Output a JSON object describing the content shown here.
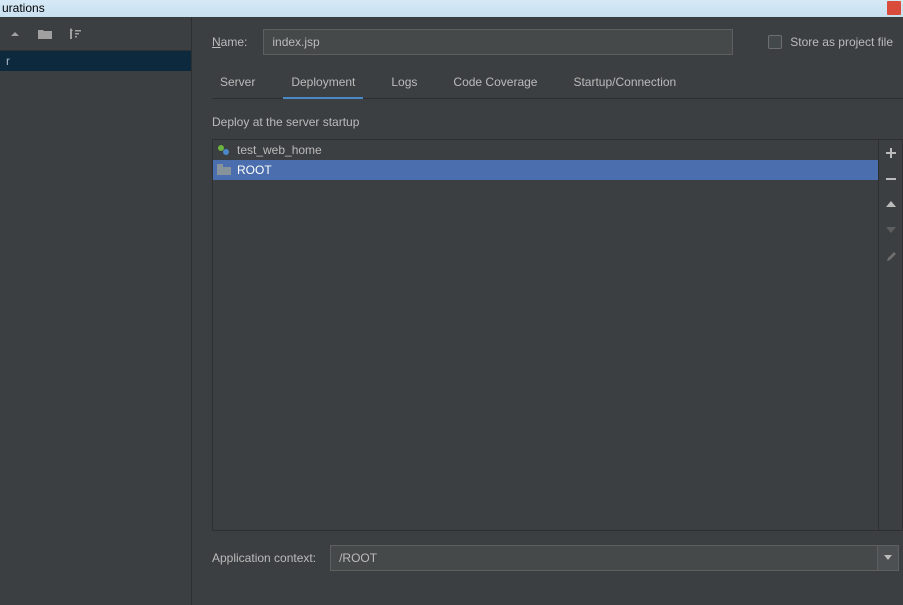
{
  "window": {
    "title_fragment": "urations"
  },
  "tree": {
    "selected_item": "r"
  },
  "nameRow": {
    "label": "ame:",
    "labelPrefix": "N",
    "value": "index.jsp",
    "storeLabel": "tore as project file",
    "storePrefix": "S"
  },
  "tabs": [
    {
      "label": "Server",
      "active": false
    },
    {
      "label": "Deployment",
      "active": true
    },
    {
      "label": "Logs",
      "active": false
    },
    {
      "label": "Code Coverage",
      "active": false
    },
    {
      "label": "Startup/Connection",
      "active": false
    }
  ],
  "deploy": {
    "label": "Deploy at the server startup",
    "items": [
      {
        "label": "test_web_home",
        "icon": "artifact",
        "selected": false
      },
      {
        "label": "ROOT",
        "icon": "folder",
        "selected": true
      }
    ]
  },
  "context": {
    "label": "Application context:",
    "value": "/ROOT"
  }
}
